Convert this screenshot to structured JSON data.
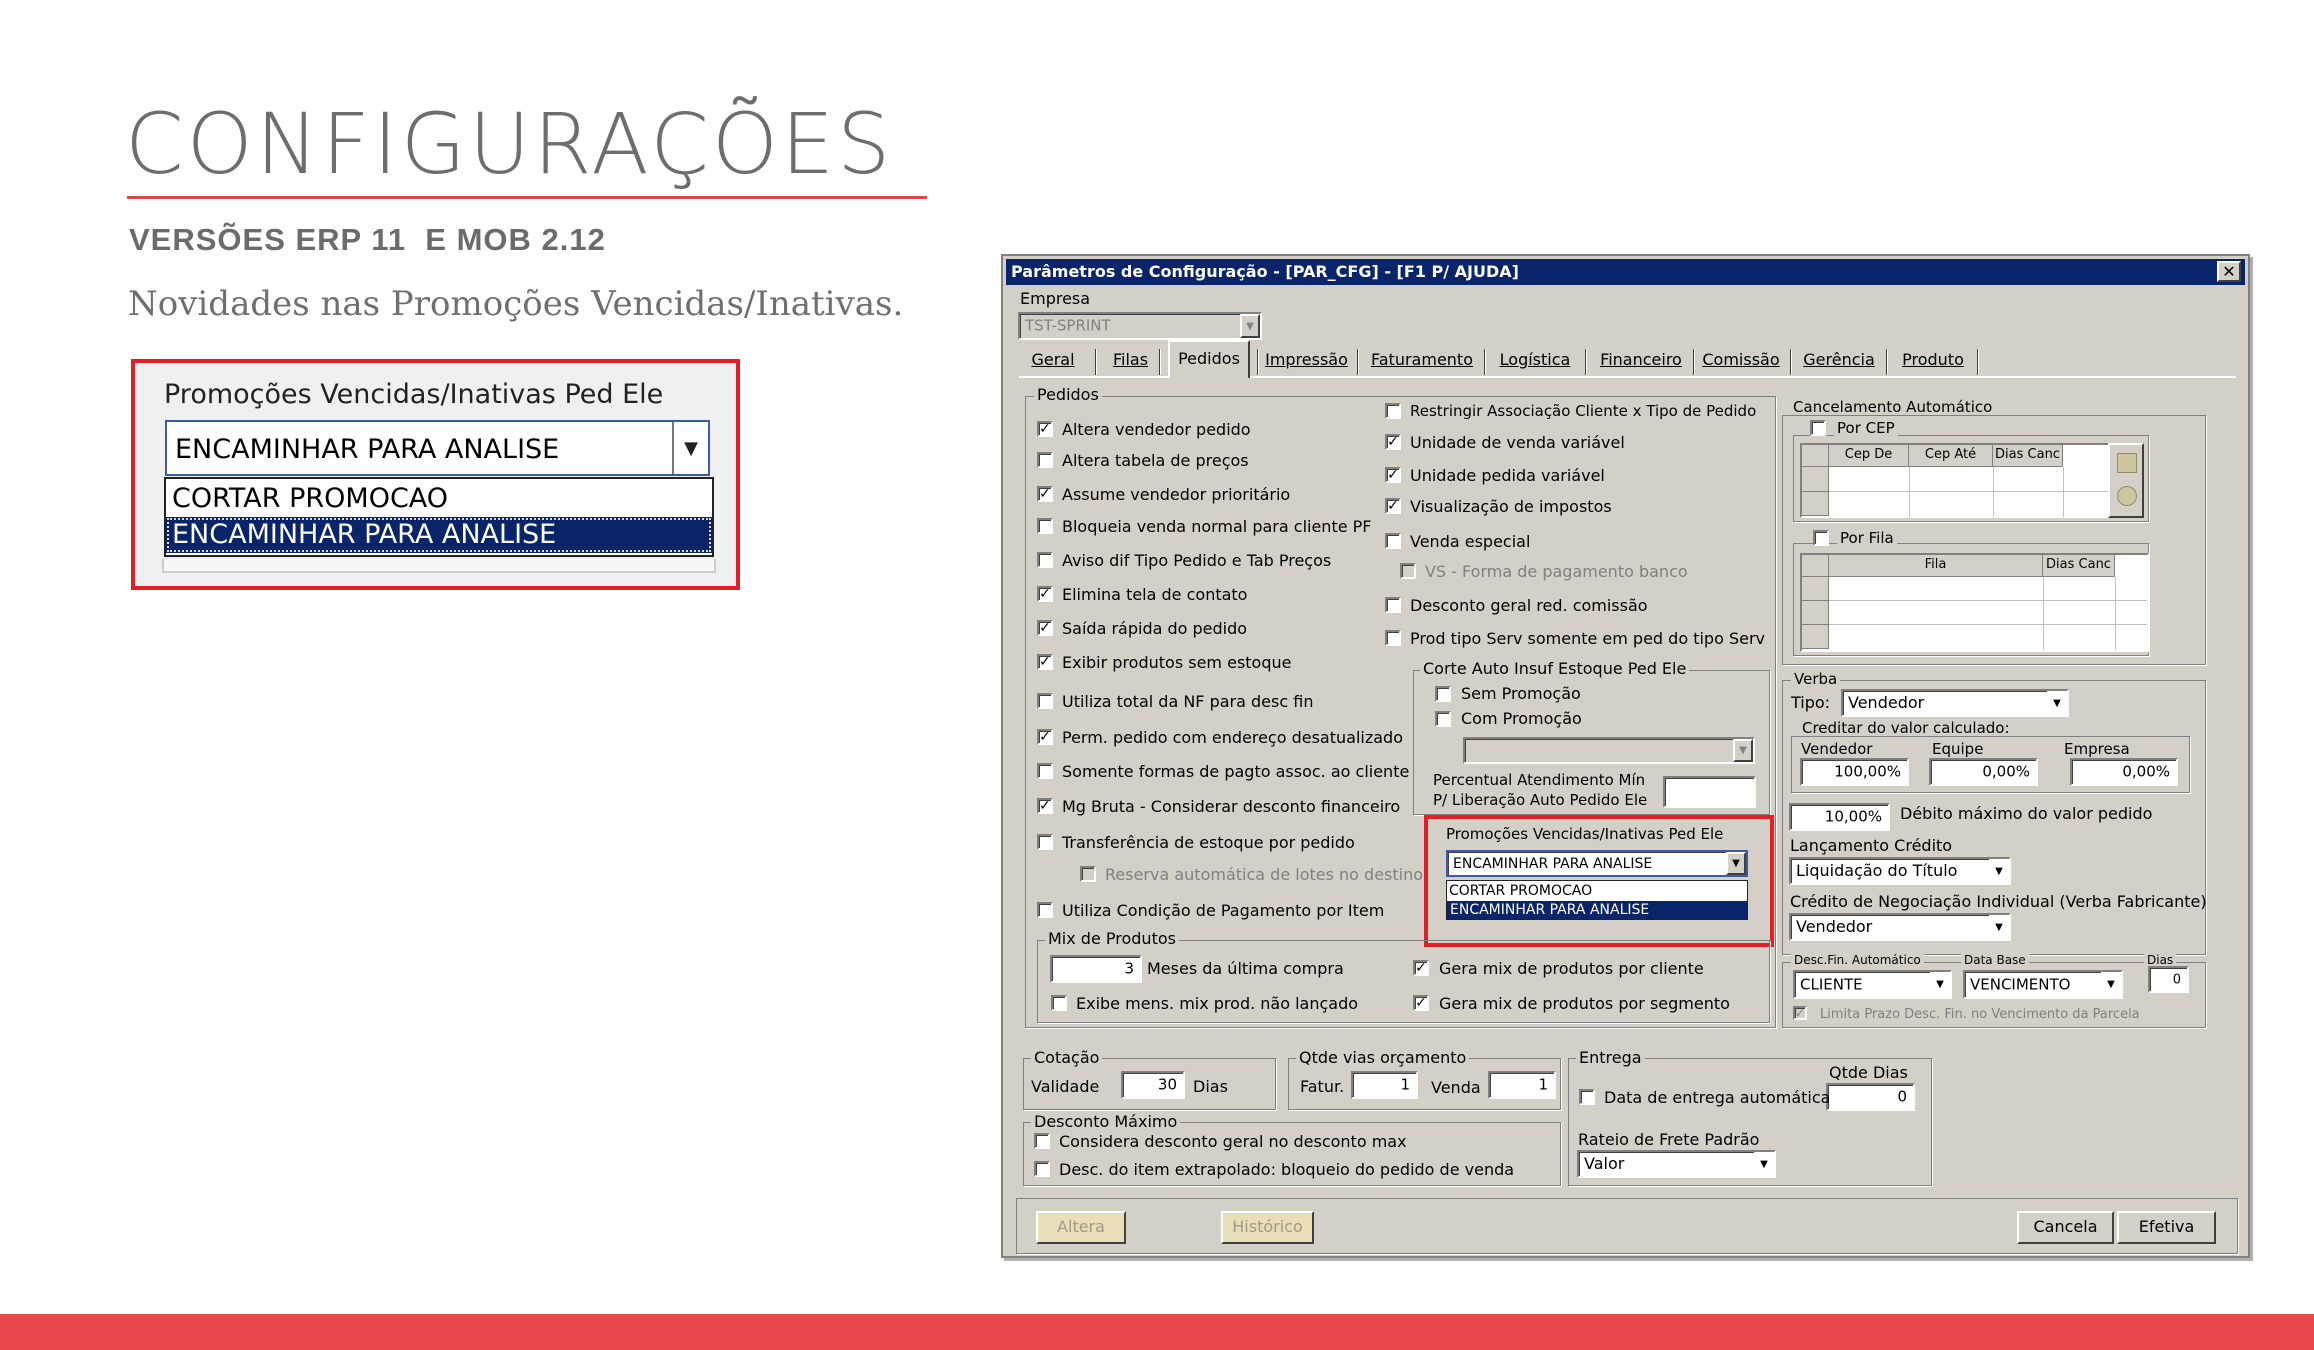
{
  "slide": {
    "title": "CONFIGURAÇÕES",
    "subtitle": "VERSÕES ERP 11  E MOB 2.12",
    "description": "Novidades nas Promoções Vencidas/Inativas.",
    "accent_color": "#e8474c"
  },
  "zoom": {
    "label": "Promoções Vencidas/Inativas Ped Ele",
    "selected": "ENCAMINHAR PARA ANALISE",
    "options": [
      "CORTAR PROMOCAO",
      "ENCAMINHAR PARA ANALISE"
    ]
  },
  "dialog": {
    "title": "Parâmetros de Configuração - [PAR_CFG] - [F1 P/ AJUDA]",
    "close_icon": "✕",
    "empresa_label": "Empresa",
    "empresa_value": "TST-SPRINT",
    "tabs": [
      "Geral",
      "Filas",
      "Pedidos",
      "Impressão",
      "Faturamento",
      "Logística",
      "Financeiro",
      "Comissão",
      "Gerência",
      "Produto"
    ],
    "active_tab": "Pedidos",
    "pedidos": {
      "group_label": "Pedidos",
      "left_checks": [
        {
          "label": "Altera vendedor pedido",
          "checked": true
        },
        {
          "label": "Altera tabela de preços",
          "checked": false
        },
        {
          "label": "Assume vendedor prioritário",
          "checked": true
        },
        {
          "label": "Bloqueia venda normal para cliente PF",
          "checked": false
        },
        {
          "label": "Aviso dif Tipo Pedido e Tab Preços",
          "checked": false
        },
        {
          "label": "Elimina tela de contato",
          "checked": true
        },
        {
          "label": "Saída rápida do pedido",
          "checked": true
        },
        {
          "label": "Exibir produtos sem estoque",
          "checked": true
        },
        {
          "label": "Utiliza total da NF para desc fin",
          "checked": false
        },
        {
          "label": "Perm. pedido com endereço desatualizado",
          "checked": true
        },
        {
          "label": "Somente formas de pagto assoc. ao cliente",
          "checked": false
        },
        {
          "label": "Mg Bruta - Considerar desconto financeiro",
          "checked": true
        },
        {
          "label": "Transferência de estoque por pedido",
          "checked": false
        },
        {
          "label": "Reserva automática de lotes no destino",
          "checked": false
        },
        {
          "label": "Utiliza Condição de Pagamento por Item",
          "checked": false
        }
      ],
      "right_checks": [
        {
          "label": "Restringir Associação Cliente x Tipo de Pedido",
          "checked": false
        },
        {
          "label": "Unidade de venda variável",
          "checked": true
        },
        {
          "label": "Unidade pedida variável",
          "checked": true
        },
        {
          "label": "Visualização de impostos",
          "checked": true
        },
        {
          "label": "Venda especial",
          "checked": false
        },
        {
          "label": "VS - Forma de pagamento banco",
          "checked": false
        },
        {
          "label": "Desconto geral red. comissão",
          "checked": false
        },
        {
          "label": "Prod tipo Serv somente em ped do tipo Serv",
          "checked": false
        }
      ],
      "corte_group": "Corte Auto Insuf Estoque Ped Ele",
      "corte_checks": [
        {
          "label": "Sem Promoção",
          "checked": false
        },
        {
          "label": "Com Promoção",
          "checked": false
        }
      ],
      "percentual_line1": "Percentual Atendimento Mín",
      "percentual_line2": "P/ Liberação Auto Pedido Ele",
      "promo_label": "Promoções Vencidas/Inativas Ped Ele",
      "promo_selected": "ENCAMINHAR PARA ANALISE",
      "promo_options": [
        "CORTAR PROMOCAO",
        "ENCAMINHAR PARA ANALISE"
      ],
      "mix_group": "Mix de Produtos",
      "mix_meses_value": "3",
      "mix_meses_label": "Meses da última compra",
      "mix_exibe": {
        "label": "Exibe mens. mix prod. não lançado",
        "checked": false
      },
      "mix_cliente": {
        "label": "Gera mix de produtos por cliente",
        "checked": true
      },
      "mix_segmento": {
        "label": "Gera mix de produtos por segmento",
        "checked": true
      }
    },
    "cancel_auto": {
      "group_label": "Cancelamento Automático",
      "por_cep": {
        "label": "Por CEP",
        "checked": false
      },
      "cep_cols": [
        "Cep De",
        "Cep Até",
        "Dias Canc"
      ],
      "por_fila": {
        "label": "Por Fila",
        "checked": false
      },
      "fila_cols": [
        "Fila",
        "Dias Canc"
      ]
    },
    "verba": {
      "group_label": "Verba",
      "tipo_label": "Tipo:",
      "tipo_value": "Vendedor",
      "creditar_group": "Creditar do valor calculado:",
      "cols": [
        "Vendedor",
        "Equipe",
        "Empresa"
      ],
      "values": [
        "100,00%",
        "0,00%",
        "0,00%"
      ],
      "debito_value": "10,00%",
      "debito_label": "Débito máximo do valor pedido",
      "lanc_label": "Lançamento Crédito",
      "lanc_value": "Liquidação do Título",
      "cred_label": "Crédito de Negociação Individual (Verba Fabricante)",
      "cred_value": "Vendedor"
    },
    "desc_fin": {
      "label": "Desc.Fin. Automático",
      "value": "CLIENTE",
      "database_label": "Data Base",
      "database_value": "VENCIMENTO",
      "dias_label": "Dias",
      "dias_value": "0",
      "limita": {
        "label": "Limita Prazo Desc. Fin. no Vencimento da Parcela",
        "checked": true
      }
    },
    "cotacao": {
      "group": "Cotação",
      "validade_label": "Validade",
      "validade_value": "30",
      "dias_label": "Dias"
    },
    "qtde_vias": {
      "group": "Qtde vias orçamento",
      "fatur_label": "Fatur.",
      "fatur_value": "1",
      "venda_label": "Venda",
      "venda_value": "1"
    },
    "entrega": {
      "group": "Entrega",
      "qtde_dias_label": "Qtde Dias",
      "qtde_dias_value": "0",
      "data_auto": {
        "label": "Data de entrega automática",
        "checked": false
      },
      "rateio_label": "Rateio de Frete Padrão",
      "rateio_value": "Valor"
    },
    "desc_max": {
      "group": "Desconto Máximo",
      "checks": [
        {
          "label": "Considera desconto geral no desconto max",
          "checked": false
        },
        {
          "label": "Desc. do item extrapolado: bloqueio do pedido de venda",
          "checked": false
        }
      ]
    },
    "buttons": {
      "altera": "Altera",
      "historico": "Histórico",
      "cancela": "Cancela",
      "efetiva": "Efetiva"
    }
  }
}
